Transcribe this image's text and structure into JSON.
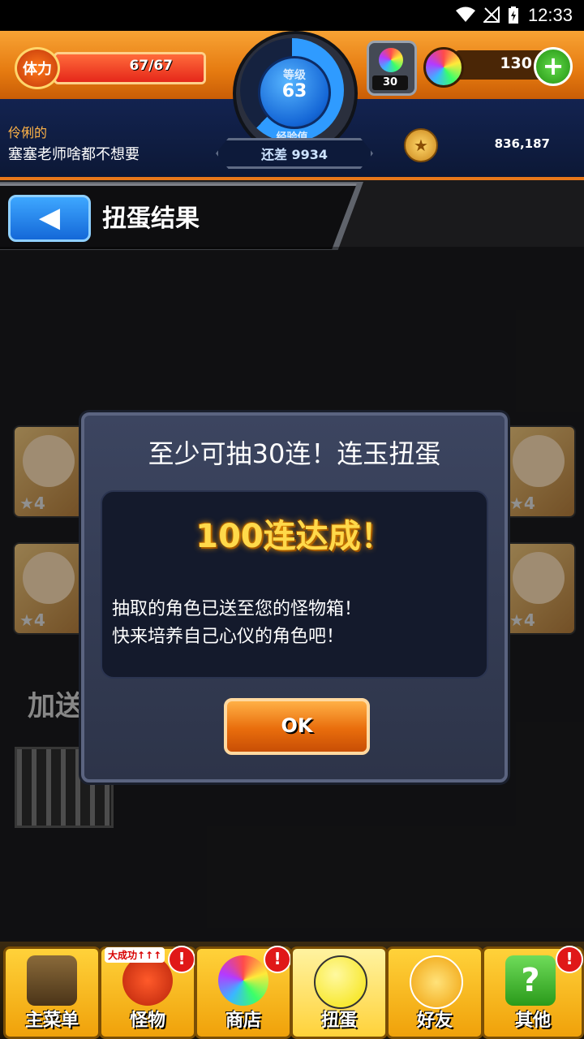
{
  "status_bar": {
    "time": "12:33"
  },
  "header": {
    "stamina_label": "体力",
    "stamina_value": "67/67",
    "stamina_fraction": 1.0,
    "level_label": "等级",
    "level": "63",
    "exp_label": "经验值",
    "exp_remaining": "还差 9934",
    "egg_count": "30",
    "orb_count": "130",
    "player_title": "伶俐的",
    "player_name": "塞塞老师啥都不想要",
    "coin_count": "836,187"
  },
  "title_bar": {
    "title": "扭蛋结果",
    "back_icon": "arrow-left-icon"
  },
  "background": {
    "star_label": "★4",
    "bonus_text": "加送"
  },
  "dialog": {
    "title": "至少可抽30连！连玉扭蛋",
    "achievement": "100连达成！",
    "message_line1": "抽取的角色已送至您的怪物箱！",
    "message_line2": "快来培养自己心仪的角色吧！",
    "ok_label": "OK"
  },
  "nav": {
    "items": [
      {
        "label": "主菜单",
        "icon": "gate-icon",
        "badge": ""
      },
      {
        "label": "怪物",
        "icon": "monster-icon",
        "badge": "!",
        "tag": "大成功↑↑↑"
      },
      {
        "label": "商店",
        "icon": "orb-icon",
        "badge": "!"
      },
      {
        "label": "扭蛋",
        "icon": "egg-icon",
        "badge": ""
      },
      {
        "label": "好友",
        "icon": "friends-icon",
        "badge": ""
      },
      {
        "label": "其他",
        "icon": "question-icon",
        "badge": "!"
      }
    ]
  },
  "colors": {
    "header_orange": "#e57a10",
    "header_blue": "#0c1836",
    "dialog_bg": "#2d3449",
    "achievement_gold": "#ffd94a",
    "ok_orange": "#e96d0c"
  }
}
